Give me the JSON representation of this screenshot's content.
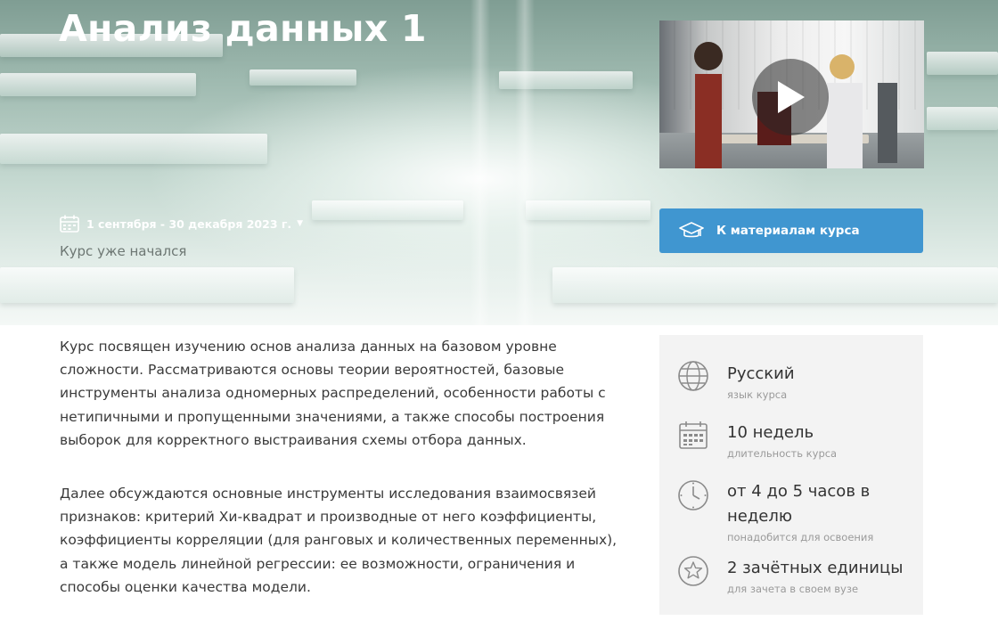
{
  "course": {
    "title": "Анализ данных 1",
    "dates": "1 сентября - 30 декабря 2023 г.",
    "status": "Курс уже начался",
    "materials_button": "К материалам курса"
  },
  "description": {
    "paragraphs": [
      "Курс посвящен изучению основ анализа данных на базовом уровне сложности. Рассматриваются основы теории вероятностей, базовые инструменты анализа одномерных распределений, особенности работы с нетипичными и пропущенными значениями, а также способы построения выборок для корректного выстраивания схемы отбора данных.",
      "Далее обсуждаются основные инструменты исследования взаимосвязей признаков: критерий Хи-квадрат и производные от него коэффициенты, коэффициенты корреляции (для ранговых и количественных переменных), а также модель линейной регрессии: ее возможности, ограничения и способы оценки качества модели."
    ]
  },
  "info": [
    {
      "icon": "globe-icon",
      "value": "Русский",
      "label": "язык курса"
    },
    {
      "icon": "calendar-icon",
      "value": "10 недель",
      "label": "длительность курса"
    },
    {
      "icon": "clock-icon",
      "value": "от 4 до 5 часов в неделю",
      "label": "понадобится для освоения"
    },
    {
      "icon": "star-icon",
      "value": "2 зачётных единицы",
      "label": "для зачета в своем вузе"
    }
  ],
  "colors": {
    "accent": "#4096d0",
    "panel_bg": "#f3f3f3"
  }
}
